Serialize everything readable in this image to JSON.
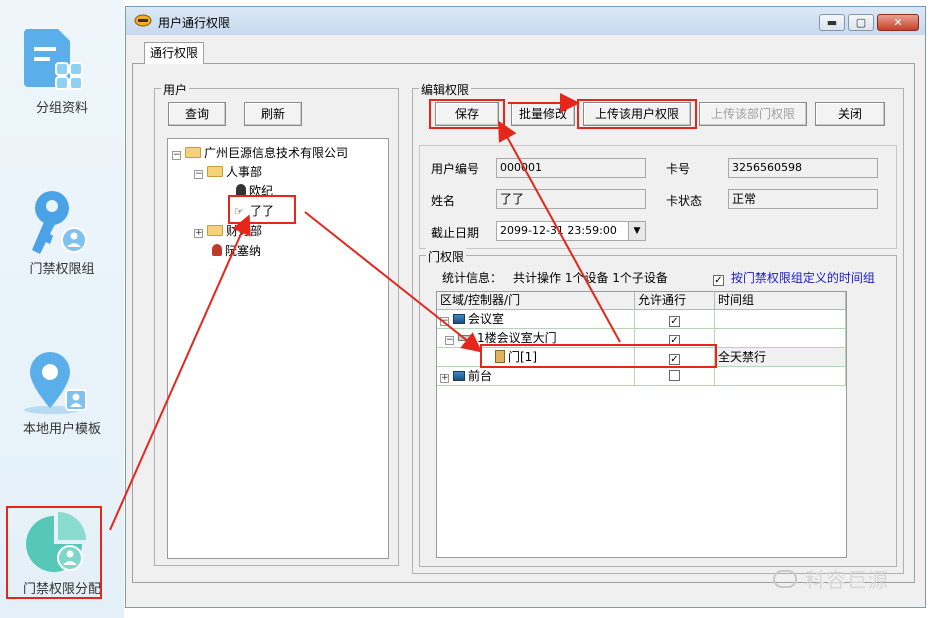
{
  "left_nav": {
    "items": [
      {
        "label": "分组资料",
        "icon": "group-info-icon"
      },
      {
        "label": "门禁权限组",
        "icon": "access-key-group-icon"
      },
      {
        "label": "本地用户模板",
        "icon": "location-user-template-icon"
      },
      {
        "label": "门禁权限分配",
        "icon": "access-assign-pie-icon"
      }
    ]
  },
  "window": {
    "title": "用户通行权限",
    "controls": {
      "minimize": "▬",
      "maximize": "▢",
      "close": "✕"
    },
    "tab_label": "通行权限"
  },
  "user_panel": {
    "title": "用户",
    "query_label": "查询",
    "refresh_label": "刷新",
    "tree": {
      "root": "广州巨源信息技术有限公司",
      "dept1": "人事部",
      "user1": "欧纪",
      "user2": "了了",
      "dept2": "财务部",
      "user3": "阮塞纳"
    }
  },
  "edit_panel": {
    "title": "编辑权限",
    "save_label": "保存",
    "batch_label": "批量修改",
    "upload_user_label": "上传该用户权限",
    "upload_dept_label": "上传该部门权限",
    "close_label": "关闭",
    "fields": {
      "user_no_label": "用户编号",
      "user_no_value": "000001",
      "card_no_label": "卡号",
      "card_no_value": "3256560598",
      "name_label": "姓名",
      "name_value": "了了",
      "card_status_label": "卡状态",
      "card_status_value": "正常",
      "expiry_label": "截止日期",
      "expiry_value": "2099-12-31 23:59:00"
    }
  },
  "door_panel": {
    "title": "门权限",
    "stats_label": "统计信息：",
    "stats_value": "共计操作 1个设备 1个子设备",
    "timegroup_checkbox_label": "按门禁权限组定义的时间组",
    "columns": [
      "区域/控制器/门",
      "允许通行",
      "时间组"
    ],
    "rows": [
      {
        "name": "会议室",
        "allowed": true,
        "timegroup": ""
      },
      {
        "name": "1楼会议室大门",
        "allowed": true,
        "timegroup": ""
      },
      {
        "name": "门[1]",
        "allowed": true,
        "timegroup": "全天禁行"
      },
      {
        "name": "前台",
        "allowed": false,
        "timegroup": ""
      }
    ]
  },
  "watermark": "科容巨源",
  "colors": {
    "highlight": "#e5261b",
    "nav_icon": "#4a9fe0",
    "teal": "#57c7b8"
  }
}
